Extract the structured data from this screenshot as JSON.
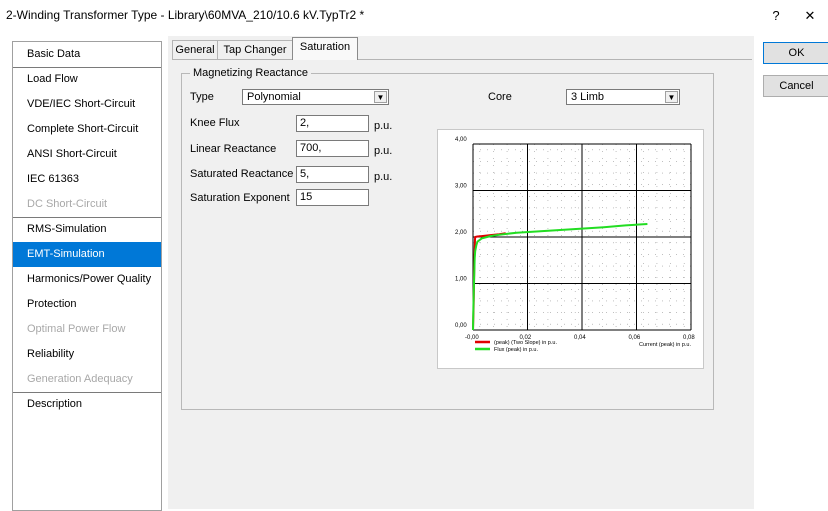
{
  "window": {
    "title": "2-Winding Transformer Type - Library\\60MVA_210/10.6 kV.TypTr2 *",
    "help_label": "?",
    "close_label": "✕"
  },
  "sidebar": {
    "items": [
      {
        "label": "Basic Data",
        "state": "normal"
      },
      {
        "label": "Load Flow",
        "state": "normal"
      },
      {
        "label": "VDE/IEC Short-Circuit",
        "state": "normal"
      },
      {
        "label": "Complete Short-Circuit",
        "state": "normal"
      },
      {
        "label": "ANSI Short-Circuit",
        "state": "normal"
      },
      {
        "label": "IEC 61363",
        "state": "normal"
      },
      {
        "label": "DC Short-Circuit",
        "state": "disabled"
      },
      {
        "label": "RMS-Simulation",
        "state": "normal"
      },
      {
        "label": "EMT-Simulation",
        "state": "selected"
      },
      {
        "label": "Harmonics/Power Quality",
        "state": "normal"
      },
      {
        "label": "Protection",
        "state": "normal"
      },
      {
        "label": "Optimal Power Flow",
        "state": "disabled"
      },
      {
        "label": "Reliability",
        "state": "normal"
      },
      {
        "label": "Generation Adequacy",
        "state": "disabled"
      },
      {
        "label": "Description",
        "state": "normal"
      }
    ]
  },
  "tabs": [
    {
      "label": "General",
      "active": false
    },
    {
      "label": "Tap Changer",
      "active": false
    },
    {
      "label": "Saturation",
      "active": true
    }
  ],
  "group": {
    "title": "Magnetizing Reactance",
    "type_label": "Type",
    "type_value": "Polynomial",
    "core_label": "Core",
    "core_value": "3 Limb",
    "knee_flux_label": "Knee Flux",
    "knee_flux_value": "2,",
    "knee_flux_unit": "p.u.",
    "linear_reactance_label": "Linear Reactance",
    "linear_reactance_value": "700,",
    "linear_reactance_unit": "p.u.",
    "saturated_reactance_label": "Saturated Reactance",
    "saturated_reactance_value": "5,",
    "saturated_reactance_unit": "p.u.",
    "saturation_exponent_label": "Saturation Exponent",
    "saturation_exponent_value": "15"
  },
  "buttons": {
    "ok_label": "OK",
    "cancel_label": "Cancel"
  },
  "chart_data": {
    "type": "line",
    "xlim": [
      -0.02,
      0.08
    ],
    "ylim": [
      0,
      4
    ],
    "x_ticks": [
      "-0,00",
      "0,02",
      "0,04",
      "0,06",
      "0,08"
    ],
    "y_ticks": [
      "0,00",
      "1,00",
      "2,00",
      "3,00",
      "4,00"
    ],
    "xlabel": "Current (peak) in p.u.",
    "grid": true,
    "legend_position": "bottom-left",
    "series": [
      {
        "name": "(peak) (Two Slope) in p.u.",
        "color": "#e00000",
        "x": [
          -0.02,
          -0.0197,
          -0.0194,
          -0.0191,
          -0.019,
          -0.018,
          -0.016,
          -0.012,
          -0.008,
          -0.005
        ],
        "y": [
          0.0,
          0.6,
          1.4,
          1.95,
          2.0,
          2.01,
          2.02,
          2.04,
          2.06,
          2.08
        ]
      },
      {
        "name": "Flux (peak) in p.u.",
        "color": "#22dd22",
        "x": [
          -0.02,
          -0.0198,
          -0.0195,
          -0.0192,
          -0.019,
          -0.0185,
          -0.018,
          -0.016,
          -0.012,
          -0.008,
          -0.004,
          0.0,
          0.01,
          0.02,
          0.03,
          0.04,
          0.05,
          0.06
        ],
        "y": [
          0.0,
          0.5,
          1.1,
          1.55,
          1.7,
          1.82,
          1.9,
          1.97,
          2.02,
          2.05,
          2.07,
          2.09,
          2.12,
          2.15,
          2.18,
          2.21,
          2.25,
          2.28
        ]
      }
    ]
  }
}
